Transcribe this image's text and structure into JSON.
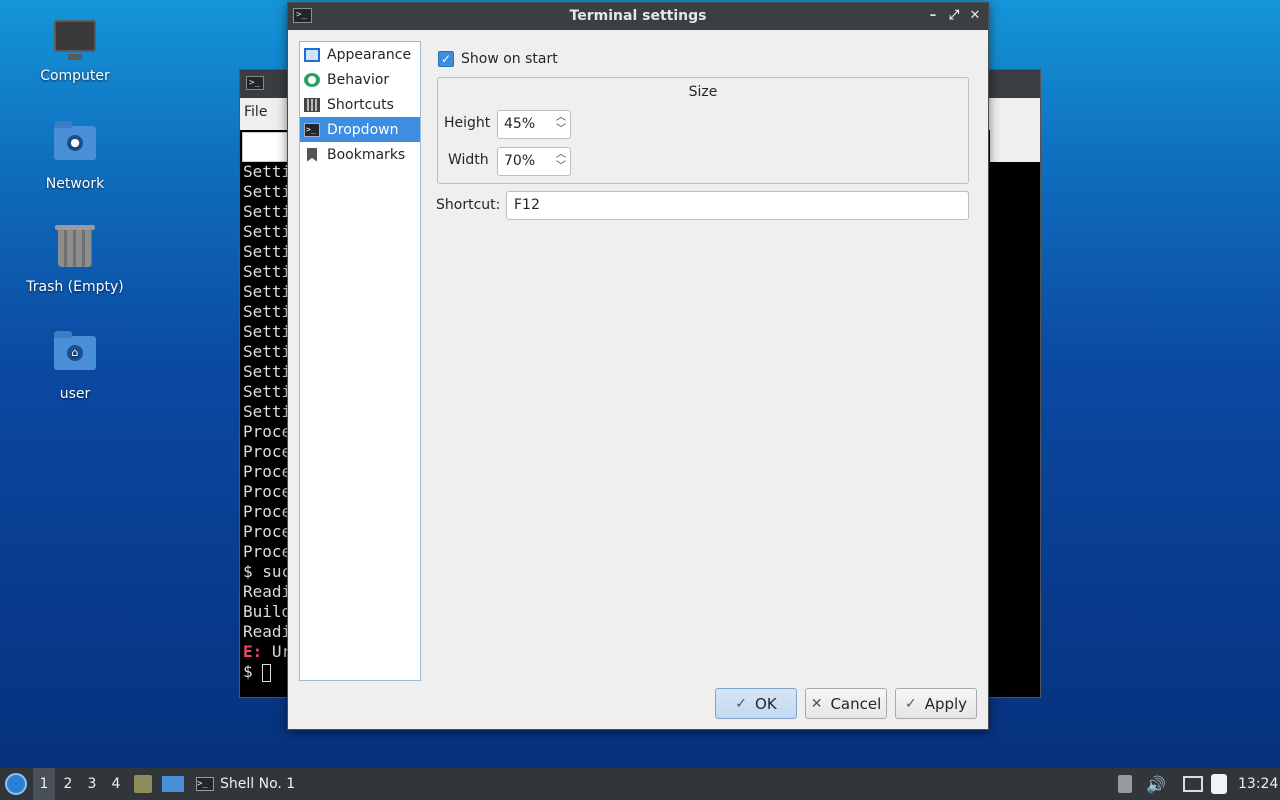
{
  "desktop": {
    "icons": [
      {
        "label": "Computer"
      },
      {
        "label": "Network"
      },
      {
        "label": "Trash (Empty)"
      },
      {
        "label": "user"
      }
    ]
  },
  "terminal": {
    "menu_file": "File",
    "lines": [
      "Setti",
      "Setti",
      "Setti",
      "Setti",
      "Setti",
      "Setti",
      "Setti",
      "Setti",
      "Setti",
      "Setti",
      "Setti",
      "Setti",
      "Setti",
      "Proce",
      "Proce",
      "Proce",
      "Proce",
      "Proce",
      "Proce",
      "Proce",
      "$ suc",
      "Readi",
      "Build",
      "Readi"
    ],
    "err_prefix": "E:",
    "err_rest": " Ur",
    "prompt": "$ "
  },
  "dialog": {
    "title": "Terminal settings",
    "nav": [
      {
        "label": "Appearance",
        "icon": "appearance-icon"
      },
      {
        "label": "Behavior",
        "icon": "behavior-icon"
      },
      {
        "label": "Shortcuts",
        "icon": "keyboard-icon"
      },
      {
        "label": "Dropdown",
        "icon": "terminal-icon",
        "selected": true
      },
      {
        "label": "Bookmarks",
        "icon": "bookmark-icon"
      }
    ],
    "show_on_start": "Show on start",
    "show_on_start_checked": true,
    "size_title": "Size",
    "height_label": "Height",
    "height_value": "45%",
    "width_label": "Width",
    "width_value": "70%",
    "shortcut_label": "Shortcut:",
    "shortcut_value": "F12",
    "ok": "OK",
    "cancel": "Cancel",
    "apply": "Apply"
  },
  "taskbar": {
    "workspaces": [
      "1",
      "2",
      "3",
      "4"
    ],
    "task_label": "Shell No. 1",
    "clock": "13:24"
  },
  "colors": {
    "accent": "#3d8ee0",
    "titlebar": "#3b3e43",
    "taskbar": "#31363b",
    "error": "#e84a5f"
  }
}
